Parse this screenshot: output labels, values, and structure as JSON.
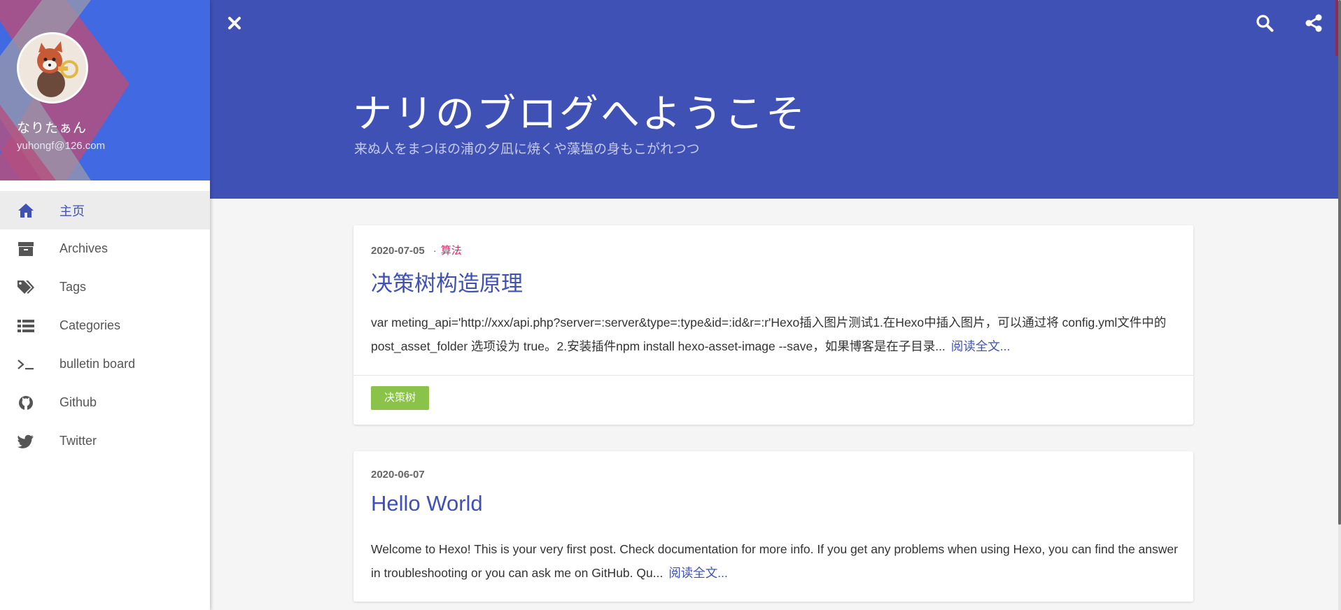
{
  "profile": {
    "name": "なりたぁん",
    "email": "yuhongf@126.com"
  },
  "sidebar": {
    "items": [
      {
        "label": "主页",
        "icon": "home-icon",
        "active": true
      },
      {
        "label": "Archives",
        "icon": "archive-icon"
      },
      {
        "label": "Tags",
        "icon": "tags-icon"
      },
      {
        "label": "Categories",
        "icon": "list-icon"
      },
      {
        "label": "bulletin board",
        "icon": "terminal-icon"
      },
      {
        "label": "Github",
        "icon": "github-icon"
      },
      {
        "label": "Twitter",
        "icon": "twitter-icon"
      }
    ]
  },
  "header": {
    "title": "ナリのブログへようこそ",
    "subtitle": "来ぬ人をまつほの浦の夕凪に焼くや藻塩の身もこがれつつ"
  },
  "posts": [
    {
      "date": "2020-07-05",
      "separator": "·",
      "category": "算法",
      "title": "决策树构造原理",
      "excerpt": "var meting_api='http://xxx/api.php?server=:server&type=:type&id=:id&r=:r'Hexo插入图片测试1.在Hexo中插入图片，可以通过将 config.yml文件中的 post_asset_folder 选项设为 true。2.安装插件npm install hexo-asset-image --save，如果博客是在子目录...",
      "read_more": "阅读全文...",
      "tag": "决策树"
    },
    {
      "date": "2020-06-07",
      "title": "Hello World",
      "excerpt": "Welcome to Hexo! This is your very first post. Check documentation for more info. If you get any problems when using Hexo, you can find the answer in troubleshooting or you can ask me on GitHub. Qu...",
      "read_more": "阅读全文..."
    }
  ],
  "colors": {
    "primary": "#3f51b5",
    "accent": "#e91e63",
    "tag": "#8bc34a",
    "profile_bg": "#4169e1"
  }
}
